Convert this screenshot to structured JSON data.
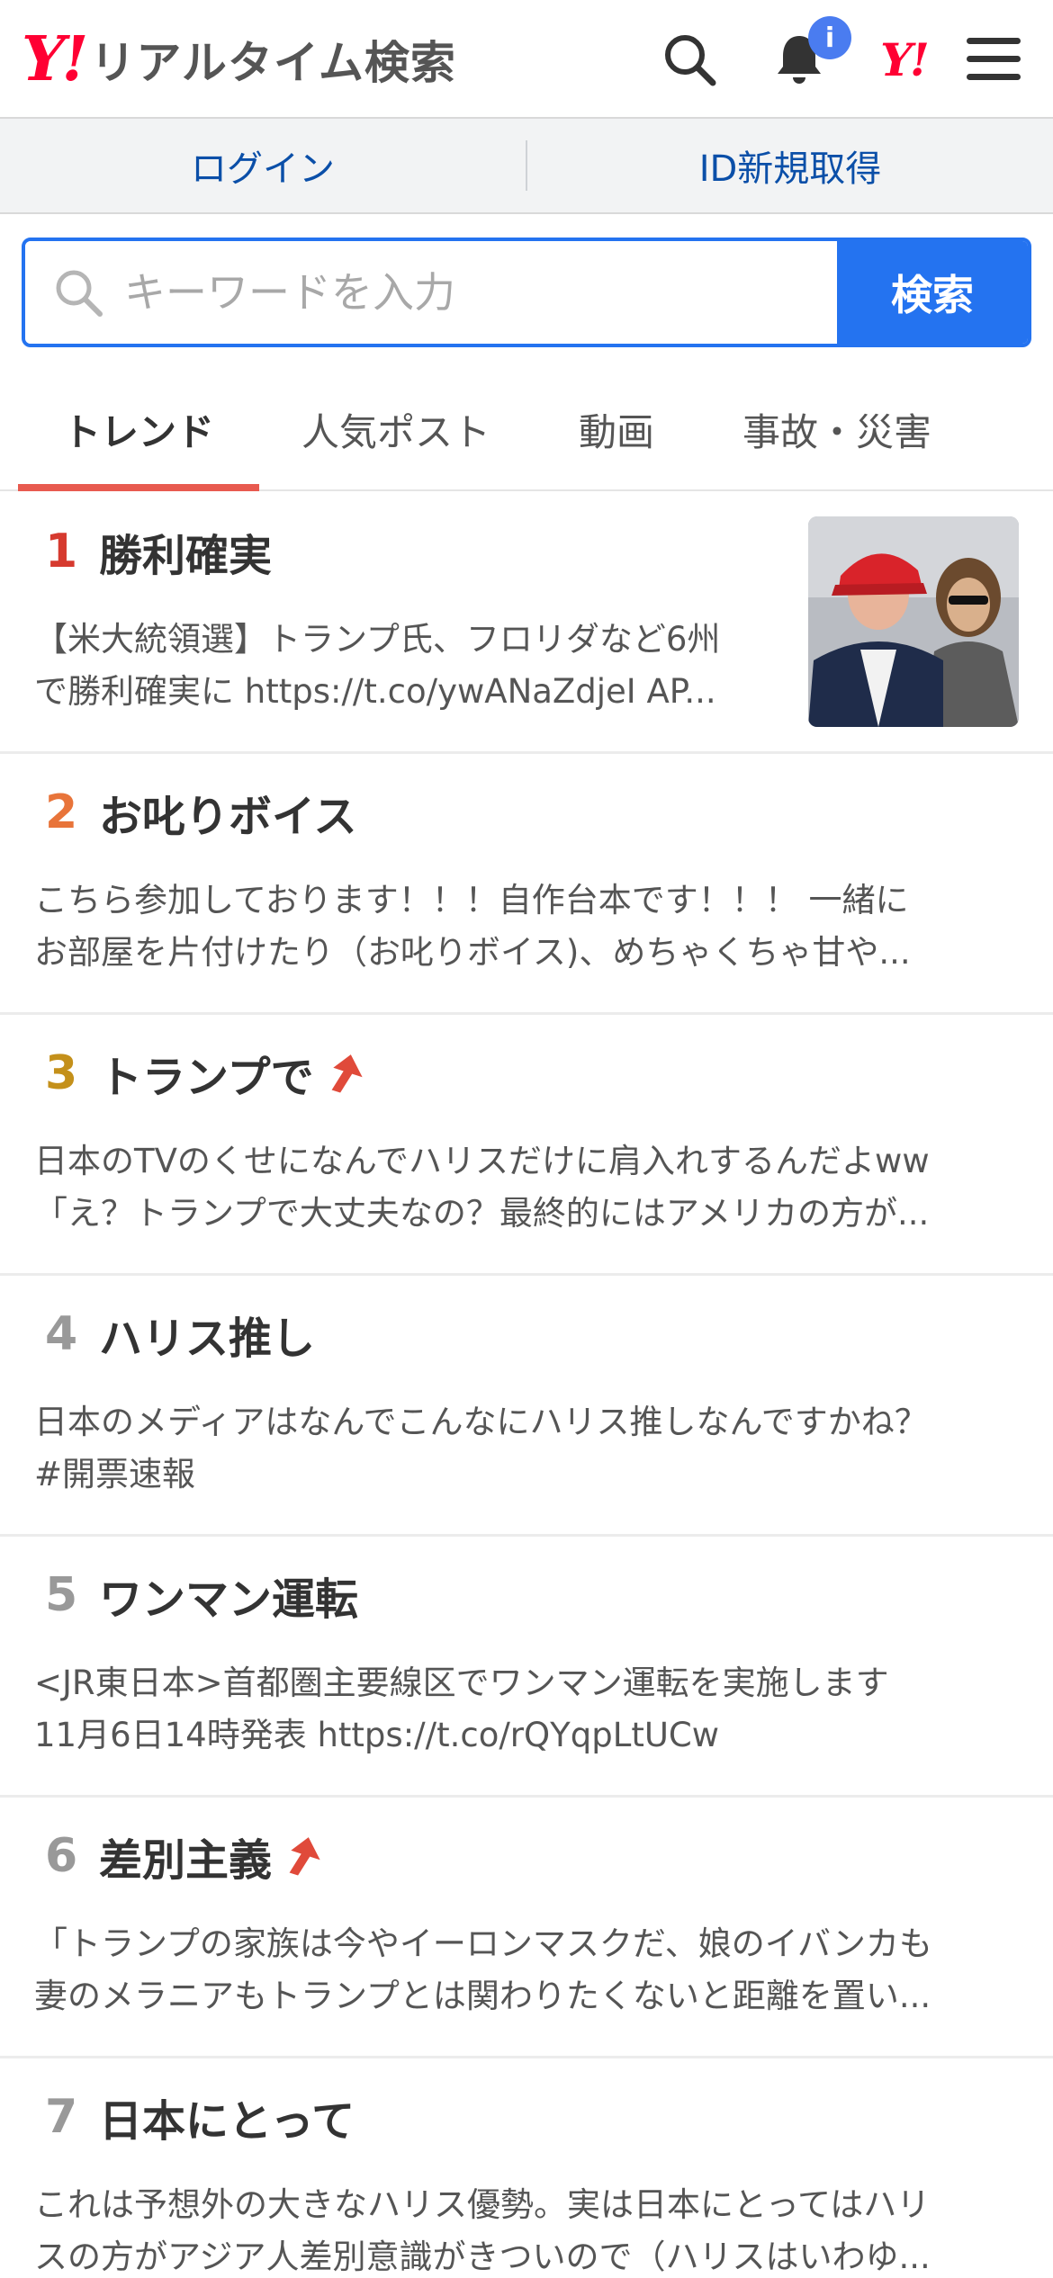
{
  "header": {
    "logo_mark": "Y!",
    "logo_text": "リアルタイム検索",
    "notification_badge": "i",
    "yj_logo": "Y!"
  },
  "login_bar": {
    "login_label": "ログイン",
    "register_label": "ID新規取得"
  },
  "search": {
    "placeholder": "キーワードを入力",
    "button_label": "検索"
  },
  "tabs": [
    {
      "label": "トレンド",
      "active": true
    },
    {
      "label": "人気ポスト",
      "active": false
    },
    {
      "label": "動画",
      "active": false
    },
    {
      "label": "事故・災害",
      "active": false
    }
  ],
  "colors": {
    "brand_red": "#ff0033",
    "accent_blue": "#2473f0",
    "tab_underline": "#e85a4f",
    "rank1": "#d63a2f",
    "rank2": "#e8743a",
    "rank3": "#c4901a",
    "rank_other": "#999999",
    "up_arrow": "#e04a3a"
  },
  "trends": [
    {
      "rank": "1",
      "title": "勝利確実",
      "rising": false,
      "has_thumb": true,
      "lines": [
        "【米大統領選】トランプ氏、フロリダなど6州",
        "で勝利確実に https://t.co/ywANaZdjeI AP..."
      ]
    },
    {
      "rank": "2",
      "title": "お叱りボイス",
      "rising": false,
      "has_thumb": false,
      "lines": [
        "こちら参加しております！！！自作台本です！！！ 一緒に",
        "お部屋を片付けたり（お叱りボイス)、めちゃくちゃ甘や..."
      ]
    },
    {
      "rank": "3",
      "title": "トランプで",
      "rising": true,
      "has_thumb": false,
      "lines": [
        "日本のTVのくせになんでハリスだけに肩入れするんだよww",
        "「え？トランプで大丈夫なの？最終的にはアメリカの方が..."
      ]
    },
    {
      "rank": "4",
      "title": "ハリス推し",
      "rising": false,
      "has_thumb": false,
      "lines": [
        "日本のメディアはなんでこんなにハリス推しなんですかね？",
        "#開票速報"
      ]
    },
    {
      "rank": "5",
      "title": "ワンマン運転",
      "rising": false,
      "has_thumb": false,
      "lines": [
        "<JR東日本>首都圏主要線区でワンマン運転を実施します",
        "11月6日14時発表 https://t.co/rQYqpLtUCw"
      ]
    },
    {
      "rank": "6",
      "title": "差別主義",
      "rising": true,
      "has_thumb": false,
      "lines": [
        "「トランプの家族は今やイーロンマスクだ、娘のイバンカも",
        "妻のメラニアもトランプとは関わりたくないと距離を置い..."
      ]
    },
    {
      "rank": "7",
      "title": "日本にとって",
      "rising": false,
      "has_thumb": false,
      "lines": [
        "これは予想外の大きなハリス優勢。実は日本にとってはハリ",
        "スの方がアジア人差別意識がきついので（ハリスはいわゆ..."
      ]
    }
  ]
}
